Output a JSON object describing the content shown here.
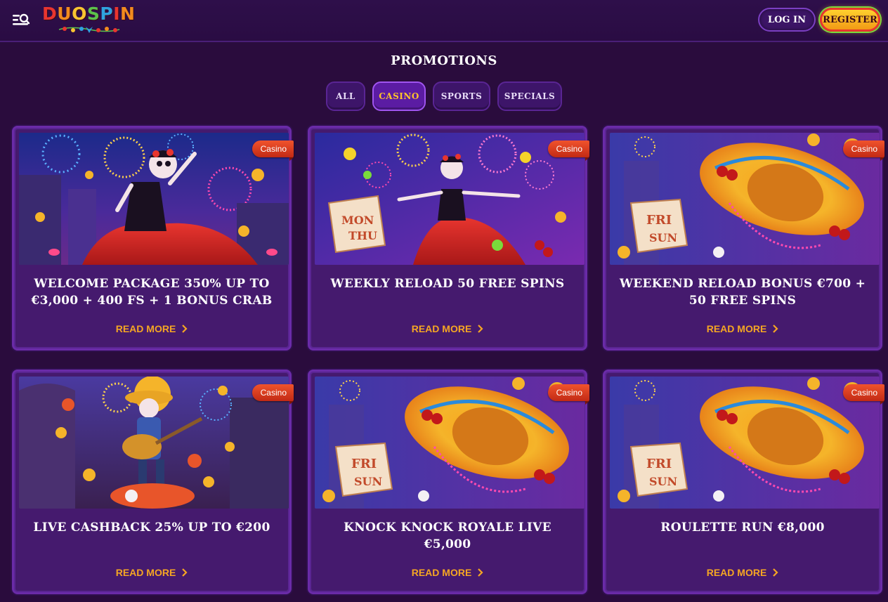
{
  "header": {
    "logo_text": "DUOSPIN",
    "login_label": "LOG IN",
    "register_label": "REGISTER",
    "menu_icon": "menu-search-icon"
  },
  "page_title": "PROMOTIONS",
  "tabs": [
    {
      "label": "ALL",
      "active": false
    },
    {
      "label": "CASINO",
      "active": true
    },
    {
      "label": "SPORTS",
      "active": false
    },
    {
      "label": "SPECIALS",
      "active": false
    }
  ],
  "cards": [
    {
      "badge": "Casino",
      "title": "WELCOME PACKAGE 350% UP TO €3,000 + 400 FS + 1 BONUS CRAB",
      "cta": "READ MORE",
      "image": "dancer-fireworks"
    },
    {
      "badge": "Casino",
      "title": "WEEKLY RELOAD 50 FREE SPINS",
      "cta": "READ MORE",
      "image": "dancer-mon-thu"
    },
    {
      "badge": "Casino",
      "title": "WEEKEND RELOAD BONUS €700 + 50 FREE SPINS",
      "cta": "READ MORE",
      "image": "sombrero-fri-sun"
    },
    {
      "badge": "Casino",
      "title": "LIVE CASHBACK 25% UP TO €200",
      "cta": "READ MORE",
      "image": "guitarist"
    },
    {
      "badge": "Casino",
      "title": "KNOCK KNOCK ROYALE LIVE €5,000",
      "cta": "READ MORE",
      "image": "sombrero-fri-sun"
    },
    {
      "badge": "Casino",
      "title": "ROULETTE RUN €8,000",
      "cta": "READ MORE",
      "image": "sombrero-fri-sun"
    }
  ],
  "colors": {
    "background": "#2a0c3d",
    "card": "#451a6e",
    "accent_orange": "#f5a623",
    "active_tab_text": "#ffc42a",
    "badge_red": "#e0401f"
  }
}
